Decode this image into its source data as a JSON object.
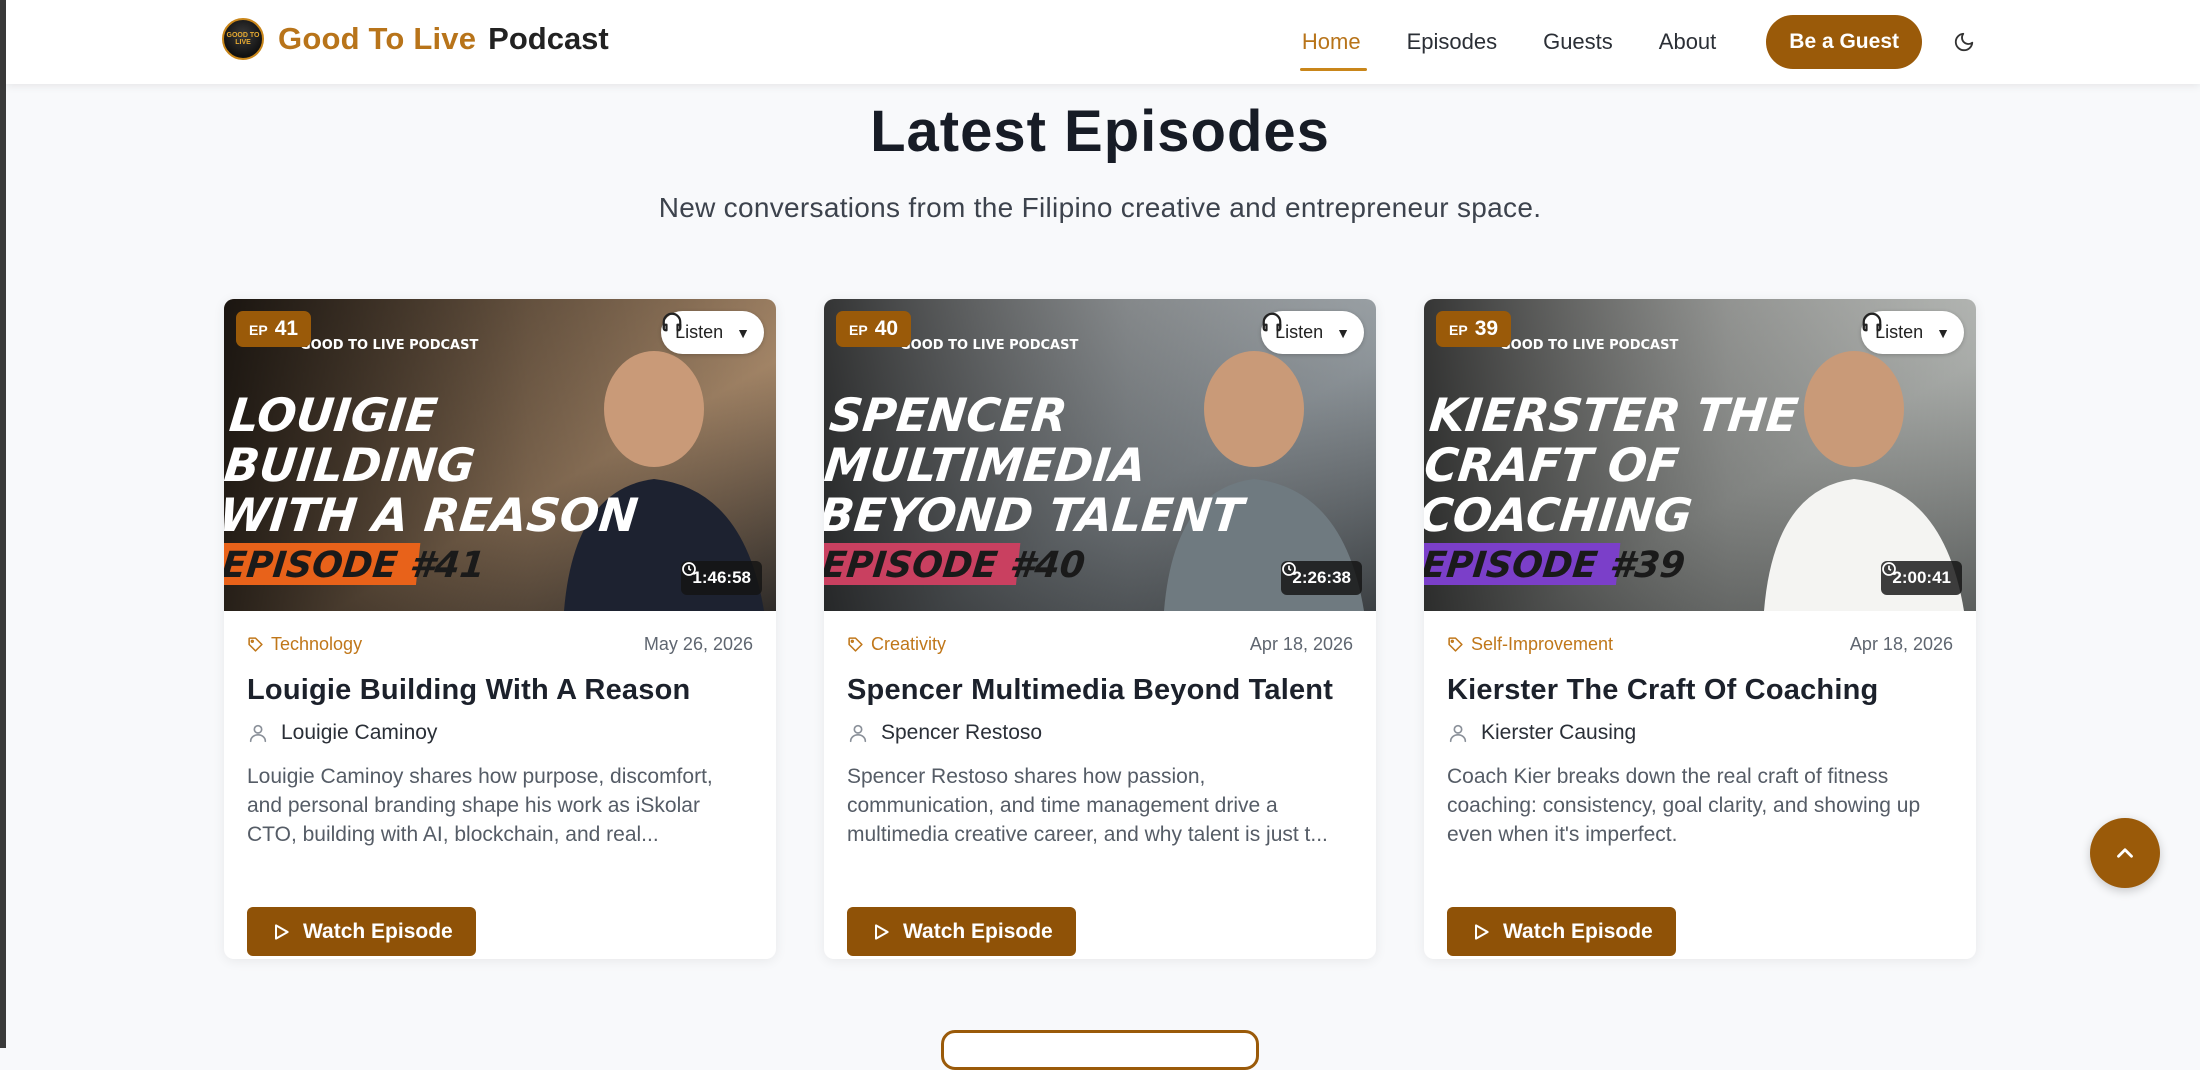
{
  "header": {
    "brand_name": "Good To Live",
    "brand_suffix": "Podcast",
    "logo_text": "GOOD TO LIVE",
    "nav": [
      {
        "label": "Home",
        "active": true
      },
      {
        "label": "Episodes",
        "active": false
      },
      {
        "label": "Guests",
        "active": false
      },
      {
        "label": "About",
        "active": false
      }
    ],
    "cta_label": "Be a Guest",
    "theme_icon": "moon-icon"
  },
  "section": {
    "title": "Latest Episodes",
    "subtitle": "New conversations from the Filipino creative and entrepreneur space."
  },
  "episodes": [
    {
      "ep_label": "EP",
      "number": "41",
      "listen_label": "Listen",
      "duration": "1:46:58",
      "thumb_lines": [
        "LOUIGIE",
        "BUILDING",
        "WITH A REASON"
      ],
      "thumb_episode": "EPISODE #41",
      "thumb_brand": "GOOD TO LIVE PODCAST",
      "category": "Technology",
      "date": "May 26, 2026",
      "title": "Louigie Building With A Reason",
      "guest": "Louigie Caminoy",
      "description": "Louigie Caminoy shares how purpose, discomfort, and personal branding shape his work as iSkolar CTO, building with AI, blockchain, and real...",
      "watch_label": "Watch Episode",
      "accent": "#e8621a"
    },
    {
      "ep_label": "EP",
      "number": "40",
      "listen_label": "Listen",
      "duration": "2:26:38",
      "thumb_lines": [
        "SPENCER",
        "MULTIMEDIA",
        "BEYOND TALENT"
      ],
      "thumb_episode": "EPISODE #40",
      "thumb_brand": "GOOD TO LIVE PODCAST",
      "category": "Creativity",
      "date": "Apr 18, 2026",
      "title": "Spencer Multimedia Beyond Talent",
      "guest": "Spencer Restoso",
      "description": "Spencer Restoso shares how passion, communication, and time management drive a multimedia creative career, and why talent is just t...",
      "watch_label": "Watch Episode",
      "accent": "#c94060"
    },
    {
      "ep_label": "EP",
      "number": "39",
      "listen_label": "Listen",
      "duration": "2:00:41",
      "thumb_lines": [
        "KIERSTER THE",
        "CRAFT OF",
        "COACHING"
      ],
      "thumb_episode": "EPISODE #39",
      "thumb_brand": "GOOD TO LIVE PODCAST",
      "category": "Self-Improvement",
      "date": "Apr 18, 2026",
      "title": "Kierster The Craft Of Coaching",
      "guest": "Kierster Causing",
      "description": "Coach Kier breaks down the real craft of fitness coaching: consistency, goal clarity, and showing up even when it's imperfect.",
      "watch_label": "Watch Episode",
      "accent": "#7b3fc9"
    }
  ]
}
